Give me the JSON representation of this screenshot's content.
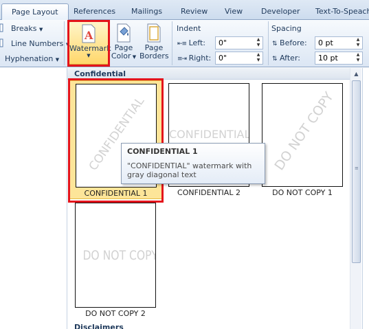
{
  "tabs": [
    "Page Layout",
    "References",
    "Mailings",
    "Review",
    "View",
    "Developer",
    "Text-To-Speach"
  ],
  "ribbon": {
    "breaks": "Breaks",
    "line_numbers": "Line Numbers",
    "hyphenation": "Hyphenation",
    "watermark": "Watermark",
    "page_color_line1": "Page",
    "page_color_line2": "Color",
    "page_borders_line1": "Page",
    "page_borders_line2": "Borders",
    "indent_label": "Indent",
    "indent_left_label": "Left:",
    "indent_left_value": "0\"",
    "indent_right_label": "Right:",
    "indent_right_value": "0\"",
    "spacing_label": "Spacing",
    "spacing_before_label": "Before:",
    "spacing_before_value": "0 pt",
    "spacing_after_label": "After:",
    "spacing_after_value": "10 pt"
  },
  "gallery": {
    "section_title": "Confidential",
    "bottom_section_title": "Disclaimers",
    "items": [
      {
        "caption": "CONFIDENTIAL 1",
        "watermark": "CONFIDENTIAL",
        "style": "diagonal",
        "selected": true
      },
      {
        "caption": "CONFIDENTIAL 2",
        "watermark": "CONFIDENTIAL",
        "style": "horizontal",
        "selected": false
      },
      {
        "caption": "DO NOT COPY 1",
        "watermark": "DO NOT COPY",
        "style": "diagonal",
        "selected": false
      },
      {
        "caption": "DO NOT COPY 2",
        "watermark": "DO NOT COPY",
        "style": "horizontal",
        "selected": false
      }
    ]
  },
  "tooltip": {
    "title": "CONFIDENTIAL 1",
    "description": "\"CONFIDENTIAL\" watermark with gray diagonal text"
  },
  "colors": {
    "highlight": "#fde599",
    "annotation_red": "#e4141b",
    "watermark_gray": "#d2d2d2"
  }
}
